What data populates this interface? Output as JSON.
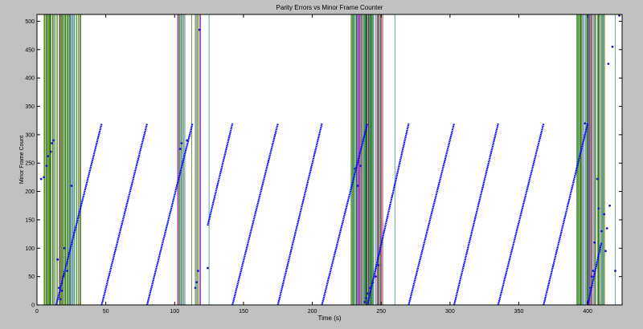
{
  "chart_data": {
    "type": "scatter",
    "title": "Parity Errors vs Minor Frame Counter",
    "xlabel": "Time (s)",
    "ylabel": "Minor Frame Count",
    "xlim": [
      0,
      425
    ],
    "ylim": [
      0,
      512
    ],
    "xticks": [
      0,
      50,
      100,
      150,
      200,
      250,
      300,
      350,
      400
    ],
    "yticks": [
      0,
      50,
      100,
      150,
      200,
      250,
      300,
      350,
      400,
      450,
      500
    ],
    "grid": false,
    "legend": "none",
    "colors": {
      "figure_bg": "#c0c0c0",
      "axes_bg": "#ffffff",
      "counter": "#0000ff",
      "counter_marker": "#1a1acc",
      "error_lines": [
        "#006400",
        "#228b22",
        "#5a8a3a",
        "#7fbf7f",
        "#cc00cc",
        "#4682b4",
        "#808000",
        "#a0a0a0"
      ]
    },
    "counter_ramps": [
      [
        14,
        47,
        0,
        320
      ],
      [
        47,
        80,
        0,
        320
      ],
      [
        80,
        113,
        0,
        320
      ],
      [
        124,
        142,
        140,
        320
      ],
      [
        142,
        175,
        0,
        320
      ],
      [
        175,
        207,
        0,
        320
      ],
      [
        207,
        240,
        0,
        320
      ],
      [
        240,
        270,
        0,
        320
      ],
      [
        270,
        303,
        0,
        320
      ],
      [
        303,
        335,
        0,
        320
      ],
      [
        335,
        368,
        0,
        320
      ],
      [
        368,
        400,
        0,
        320
      ],
      [
        400,
        410,
        0,
        110
      ]
    ],
    "error_bands": [
      [
        5,
        33,
        70
      ],
      [
        102,
        108,
        18
      ],
      [
        112,
        119,
        10
      ],
      [
        228,
        252,
        80
      ],
      [
        392,
        413,
        55
      ]
    ],
    "error_lines_extra": [
      125,
      260,
      420
    ],
    "scatter_points": [
      [
        3,
        222
      ],
      [
        5,
        225
      ],
      [
        7,
        245
      ],
      [
        8,
        262
      ],
      [
        10,
        270
      ],
      [
        11,
        285
      ],
      [
        12,
        290
      ],
      [
        15,
        80
      ],
      [
        16,
        30
      ],
      [
        17,
        10
      ],
      [
        18,
        25
      ],
      [
        19,
        50
      ],
      [
        20,
        100
      ],
      [
        22,
        60
      ],
      [
        25,
        210
      ],
      [
        104,
        275
      ],
      [
        105,
        285
      ],
      [
        109,
        290
      ],
      [
        115,
        30
      ],
      [
        116,
        40
      ],
      [
        117,
        60
      ],
      [
        118,
        485
      ],
      [
        124,
        65
      ],
      [
        231,
        240
      ],
      [
        233,
        210
      ],
      [
        235,
        245
      ],
      [
        238,
        5
      ],
      [
        239,
        12
      ],
      [
        240,
        20
      ],
      [
        242,
        30
      ],
      [
        244,
        40
      ],
      [
        246,
        50
      ],
      [
        248,
        70
      ],
      [
        398,
        320
      ],
      [
        400,
        5
      ],
      [
        402,
        30
      ],
      [
        403,
        50
      ],
      [
        404,
        60
      ],
      [
        405,
        110
      ],
      [
        407,
        222
      ],
      [
        408,
        170
      ],
      [
        410,
        130
      ],
      [
        412,
        160
      ],
      [
        413,
        95
      ],
      [
        414,
        135
      ],
      [
        415,
        425
      ],
      [
        416,
        175
      ],
      [
        418,
        455
      ],
      [
        420,
        60
      ],
      [
        423,
        510
      ]
    ]
  }
}
